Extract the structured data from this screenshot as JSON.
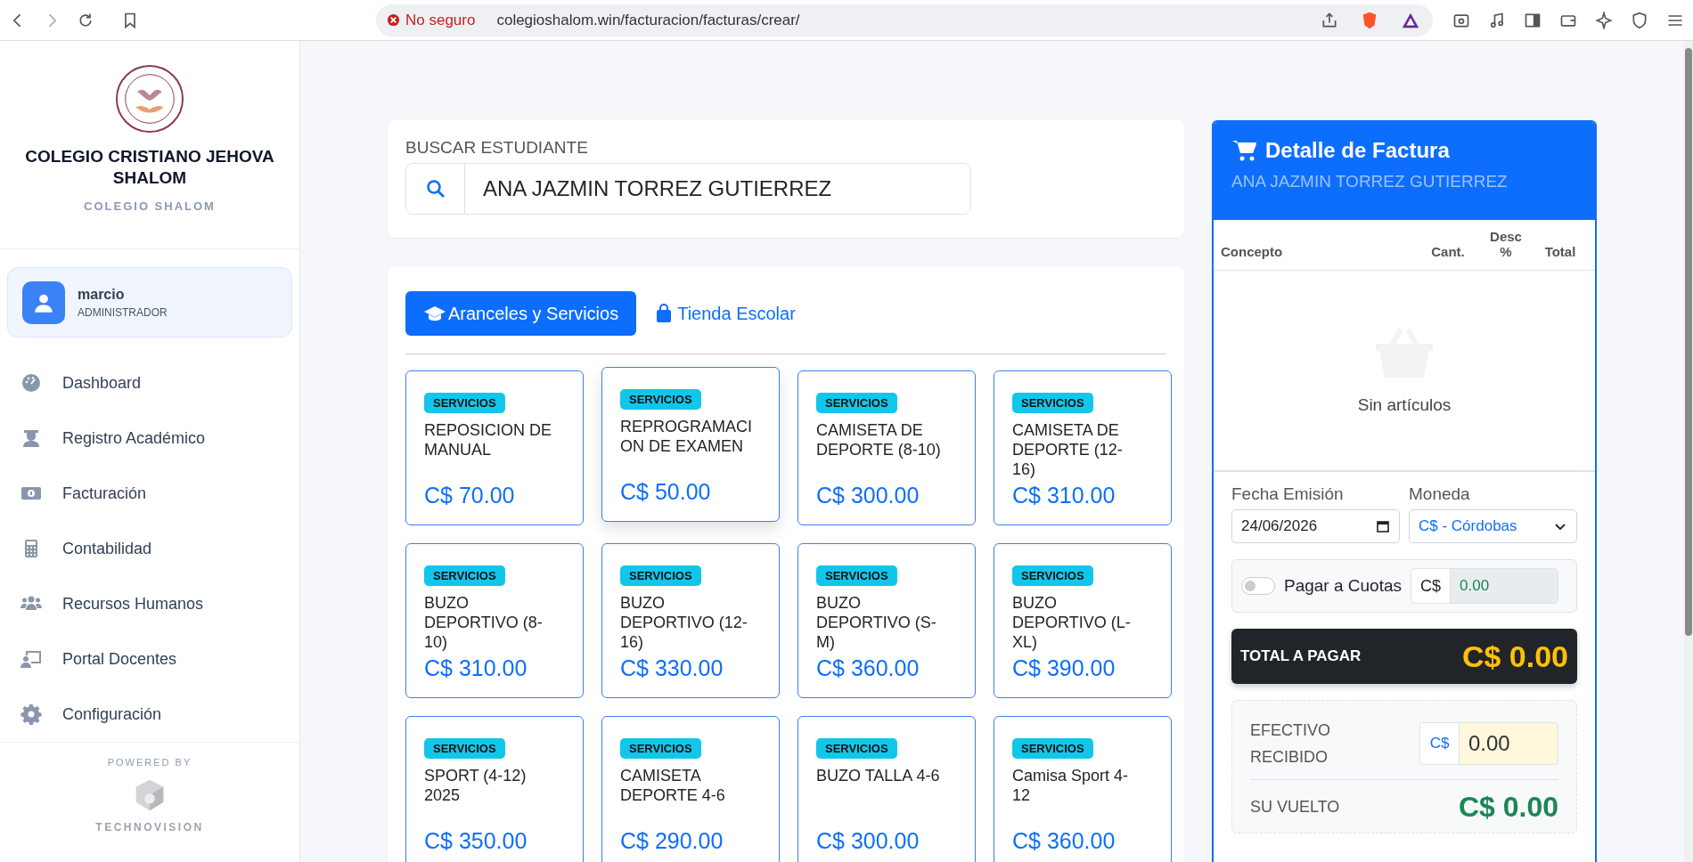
{
  "browser": {
    "security": "No seguro",
    "url": "colegioshalom.win/facturacion/facturas/crear/"
  },
  "sidebar": {
    "school_name": "COLEGIO CRISTIANO JEHOVA SHALOM",
    "school_subtitle": "COLEGIO SHALOM",
    "user": {
      "name": "marcio",
      "role": "ADMINISTRADOR"
    },
    "items": [
      {
        "label": "Dashboard",
        "kind": "gauge",
        "selected": false
      },
      {
        "label": "Registro Académico",
        "kind": "graduate",
        "selected": false
      },
      {
        "label": "Facturación",
        "kind": "money",
        "selected": false
      },
      {
        "label": "Contabilidad",
        "kind": "calculator",
        "selected": false
      },
      {
        "label": "Recursos Humanos",
        "kind": "people",
        "selected": false
      },
      {
        "label": "Portal Docentes",
        "kind": "teacher",
        "selected": false
      },
      {
        "label": "Configuración",
        "kind": "gear",
        "selected": false
      }
    ],
    "powered_by": "POWERED BY",
    "vendor": "TECHNOVISION"
  },
  "search": {
    "label": "BUSCAR ESTUDIANTE",
    "value": "ANA JAZMIN TORREZ GUTIERREZ"
  },
  "tabs": [
    {
      "label": "Aranceles y Servicios",
      "kind": "graduate",
      "selected": true
    },
    {
      "label": "Tienda Escolar",
      "kind": "bag",
      "selected": false
    }
  ],
  "products": [
    {
      "category": "SERVICIOS",
      "name": "REPOSICION DE MANUAL",
      "price": "C$ 70.00",
      "hovered": false
    },
    {
      "category": "SERVICIOS",
      "name": "REPROGRAMACI ON DE EXAMEN",
      "price": "C$ 50.00",
      "hovered": true
    },
    {
      "category": "SERVICIOS",
      "name": "CAMISETA DE DEPORTE (8-10)",
      "price": "C$ 300.00",
      "hovered": false
    },
    {
      "category": "SERVICIOS",
      "name": "CAMISETA DE DEPORTE (12-16)",
      "price": "C$ 310.00",
      "hovered": false
    },
    {
      "category": "SERVICIOS",
      "name": "BUZO DEPORTIVO (8-10)",
      "price": "C$ 310.00",
      "hovered": false
    },
    {
      "category": "SERVICIOS",
      "name": "BUZO DEPORTIVO (12-16)",
      "price": "C$ 330.00",
      "hovered": false
    },
    {
      "category": "SERVICIOS",
      "name": "BUZO DEPORTIVO (S-M)",
      "price": "C$ 360.00",
      "hovered": false
    },
    {
      "category": "SERVICIOS",
      "name": "BUZO DEPORTIVO (L-XL)",
      "price": "C$ 390.00",
      "hovered": false
    },
    {
      "category": "SERVICIOS",
      "name": "SPORT (4-12) 2025",
      "price": "C$ 350.00",
      "hovered": false
    },
    {
      "category": "SERVICIOS",
      "name": "CAMISETA DEPORTE 4-6",
      "price": "C$ 290.00",
      "hovered": false
    },
    {
      "category": "SERVICIOS",
      "name": "BUZO TALLA 4-6",
      "price": "C$ 300.00",
      "hovered": false
    },
    {
      "category": "SERVICIOS",
      "name": "Camisa Sport 4-12",
      "price": "C$ 360.00",
      "hovered": false
    }
  ],
  "invoice": {
    "title": "Detalle de Factura",
    "student": "ANA JAZMIN TORREZ GUTIERREZ",
    "columns": [
      "Concepto",
      "Cant.",
      "Desc %",
      "Total"
    ],
    "empty_text": "Sin artículos",
    "date_label": "Fecha Emisión",
    "date_value": "24/06/2026",
    "currency_label": "Moneda",
    "currency_value": "C$ - Córdobas",
    "installments": {
      "label": "Pagar a Cuotas",
      "on": false,
      "prefix": "C$",
      "value": "0.00"
    },
    "total_label": "TOTAL A PAGAR",
    "total_value": "C$ 0.00",
    "cash_label": "EFECTIVO RECIBIDO",
    "cash_prefix": "C$",
    "cash_value": "0.00",
    "change_label": "SU VUELTO",
    "change_value": "C$ 0.00"
  }
}
